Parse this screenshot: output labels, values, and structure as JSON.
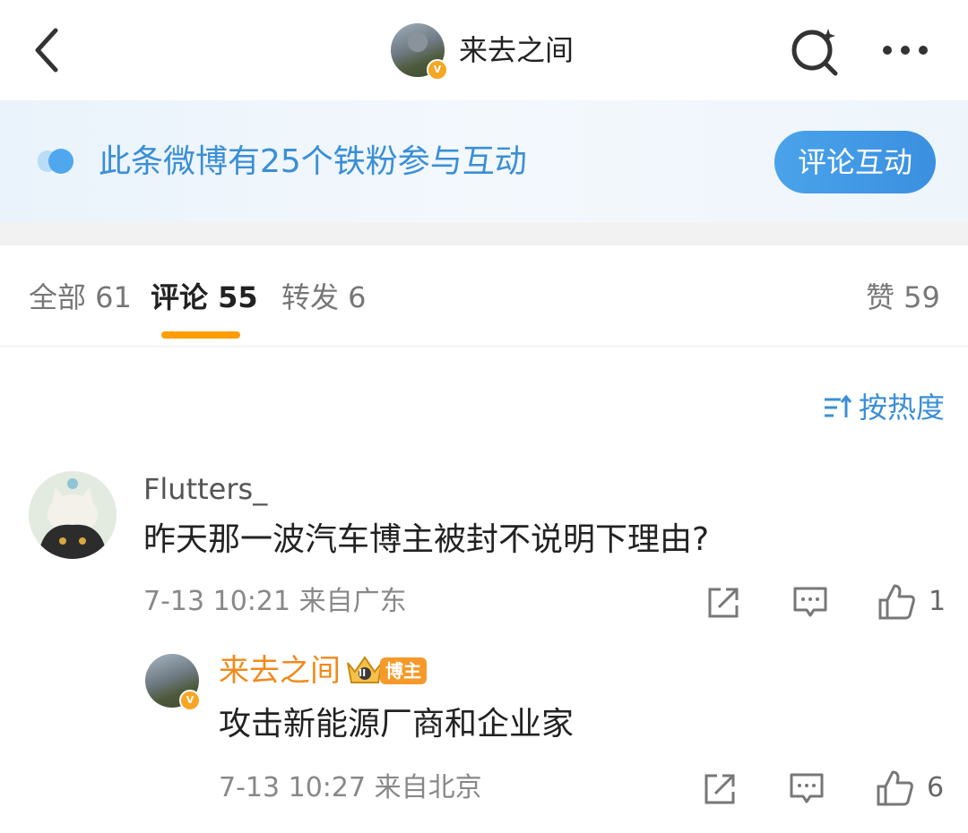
{
  "header": {
    "back_icon": "chevron-left-icon",
    "title": "来去之间",
    "avatar_badge": "V",
    "search_icon": "search-sparkle-icon",
    "more_icon": "more-dots-icon"
  },
  "banner": {
    "text": "此条微博有25个铁粉参与互动",
    "button_label": "评论互动",
    "accent": "#3a8fd6"
  },
  "tabs": [
    {
      "label": "全部 61"
    },
    {
      "label": "评论 55",
      "active": true
    },
    {
      "label": "转发 6"
    },
    {
      "label": "赞 59"
    }
  ],
  "sort": {
    "label": "按热度"
  },
  "comment": {
    "username": "Flutters_",
    "text": "昨天那一波汽车博主被封不说明下理由?",
    "meta": "7-13 10:21 来自广东",
    "likes": "1"
  },
  "reply": {
    "username": "来去之间",
    "badge": "博主",
    "crown_badge": "II",
    "text": "攻击新能源厂商和企业家",
    "meta": "7-13 10:27 来自北京",
    "likes": "6"
  },
  "colors": {
    "tab_underline": "#ff9c00",
    "author_name": "#f08a1c"
  }
}
